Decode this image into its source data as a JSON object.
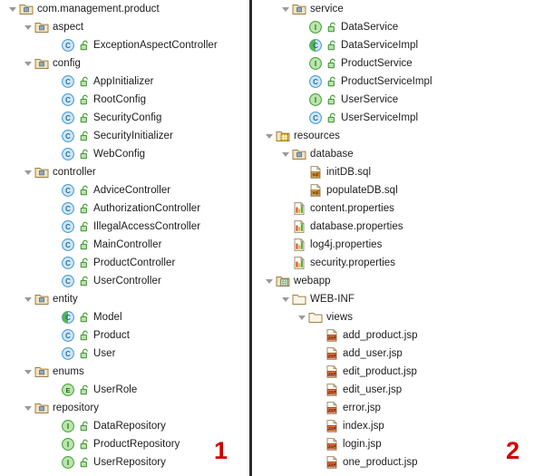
{
  "app": {
    "kind": "ide-project-tree",
    "divider_color": "#2b2b2b",
    "background": "#ffffff",
    "text_color": "#1b1b1b",
    "annotation_color": "#d00000"
  },
  "annotations": [
    {
      "label": "1",
      "panel": "left"
    },
    {
      "label": "2",
      "panel": "right"
    }
  ],
  "panels": [
    {
      "id": "left",
      "rows": [
        {
          "label": "com.management.product",
          "icon": "package-folder-icon",
          "depth": 0,
          "expanded": true
        },
        {
          "label": "aspect",
          "icon": "package-folder-icon",
          "depth": 1,
          "expanded": true
        },
        {
          "label": "ExceptionAspectController",
          "icon": "java-class-icon",
          "depth": 2,
          "vis": "public-unlock-icon"
        },
        {
          "label": "config",
          "icon": "package-folder-icon",
          "depth": 1,
          "expanded": true
        },
        {
          "label": "AppInitializer",
          "icon": "java-class-icon",
          "depth": 2,
          "vis": "public-unlock-icon"
        },
        {
          "label": "RootConfig",
          "icon": "java-class-icon",
          "depth": 2,
          "vis": "public-unlock-icon"
        },
        {
          "label": "SecurityConfig",
          "icon": "java-class-icon",
          "depth": 2,
          "vis": "public-unlock-icon"
        },
        {
          "label": "SecurityInitializer",
          "icon": "java-class-icon",
          "depth": 2,
          "vis": "public-unlock-icon"
        },
        {
          "label": "WebConfig",
          "icon": "java-class-icon",
          "depth": 2,
          "vis": "public-unlock-icon"
        },
        {
          "label": "controller",
          "icon": "package-folder-icon",
          "depth": 1,
          "expanded": true
        },
        {
          "label": "AdviceController",
          "icon": "java-class-icon",
          "depth": 2,
          "vis": "public-unlock-icon"
        },
        {
          "label": "AuthorizationController",
          "icon": "java-class-icon",
          "depth": 2,
          "vis": "public-unlock-icon"
        },
        {
          "label": "IllegalAccessController",
          "icon": "java-class-icon",
          "depth": 2,
          "vis": "public-unlock-icon"
        },
        {
          "label": "MainController",
          "icon": "java-class-icon",
          "depth": 2,
          "vis": "public-unlock-icon"
        },
        {
          "label": "ProductController",
          "icon": "java-class-icon",
          "depth": 2,
          "vis": "public-unlock-icon"
        },
        {
          "label": "UserController",
          "icon": "java-class-icon",
          "depth": 2,
          "vis": "public-unlock-icon"
        },
        {
          "label": "entity",
          "icon": "package-folder-icon",
          "depth": 1,
          "expanded": true
        },
        {
          "label": "Model",
          "icon": "java-class-green-icon",
          "depth": 2,
          "vis": "public-unlock-icon"
        },
        {
          "label": "Product",
          "icon": "java-class-icon",
          "depth": 2,
          "vis": "public-unlock-icon"
        },
        {
          "label": "User",
          "icon": "java-class-icon",
          "depth": 2,
          "vis": "public-unlock-icon"
        },
        {
          "label": "enums",
          "icon": "package-folder-icon",
          "depth": 1,
          "expanded": true
        },
        {
          "label": "UserRole",
          "icon": "java-enum-icon",
          "depth": 2,
          "vis": "public-unlock-icon"
        },
        {
          "label": "repository",
          "icon": "package-folder-icon",
          "depth": 1,
          "expanded": true
        },
        {
          "label": "DataRepository",
          "icon": "java-interface-icon",
          "depth": 2,
          "vis": "public-unlock-icon"
        },
        {
          "label": "ProductRepository",
          "icon": "java-interface-icon",
          "depth": 2,
          "vis": "public-unlock-icon"
        },
        {
          "label": "UserRepository",
          "icon": "java-interface-icon",
          "depth": 2,
          "vis": "public-unlock-icon"
        }
      ]
    },
    {
      "id": "right",
      "rows": [
        {
          "label": "service",
          "icon": "package-folder-icon",
          "depth": 1,
          "expanded": true
        },
        {
          "label": "DataService",
          "icon": "java-interface-icon",
          "depth": 2,
          "vis": "public-unlock-icon"
        },
        {
          "label": "DataServiceImpl",
          "icon": "java-class-green-icon",
          "depth": 2,
          "vis": "public-unlock-icon"
        },
        {
          "label": "ProductService",
          "icon": "java-interface-icon",
          "depth": 2,
          "vis": "public-unlock-icon"
        },
        {
          "label": "ProductServiceImpl",
          "icon": "java-class-icon",
          "depth": 2,
          "vis": "public-unlock-icon"
        },
        {
          "label": "UserService",
          "icon": "java-interface-icon",
          "depth": 2,
          "vis": "public-unlock-icon"
        },
        {
          "label": "UserServiceImpl",
          "icon": "java-class-icon",
          "depth": 2,
          "vis": "public-unlock-icon"
        },
        {
          "label": "resources",
          "icon": "resources-folder-icon",
          "depth": 0,
          "expanded": true
        },
        {
          "label": "database",
          "icon": "package-folder-icon",
          "depth": 1,
          "expanded": true
        },
        {
          "label": "initDB.sql",
          "icon": "sql-file-icon",
          "depth": 2
        },
        {
          "label": "populateDB.sql",
          "icon": "sql-file-icon",
          "depth": 2
        },
        {
          "label": "content.properties",
          "icon": "properties-file-icon",
          "depth": 1
        },
        {
          "label": "database.properties",
          "icon": "properties-file-icon",
          "depth": 1
        },
        {
          "label": "log4j.properties",
          "icon": "properties-file-icon",
          "depth": 1
        },
        {
          "label": "security.properties",
          "icon": "properties-file-icon",
          "depth": 1
        },
        {
          "label": "webapp",
          "icon": "webapp-folder-icon",
          "depth": 0,
          "expanded": true
        },
        {
          "label": "WEB-INF",
          "icon": "plain-folder-icon",
          "depth": 1,
          "expanded": true
        },
        {
          "label": "views",
          "icon": "plain-folder-icon",
          "depth": 2,
          "expanded": true
        },
        {
          "label": "add_product.jsp",
          "icon": "jsp-file-icon",
          "depth": 3
        },
        {
          "label": "add_user.jsp",
          "icon": "jsp-file-icon",
          "depth": 3
        },
        {
          "label": "edit_product.jsp",
          "icon": "jsp-file-icon",
          "depth": 3
        },
        {
          "label": "edit_user.jsp",
          "icon": "jsp-file-icon",
          "depth": 3
        },
        {
          "label": "error.jsp",
          "icon": "jsp-file-icon",
          "depth": 3
        },
        {
          "label": "index.jsp",
          "icon": "jsp-file-icon",
          "depth": 3
        },
        {
          "label": "login.jsp",
          "icon": "jsp-file-icon",
          "depth": 3
        },
        {
          "label": "one_product.jsp",
          "icon": "jsp-file-icon",
          "depth": 3
        }
      ]
    }
  ]
}
